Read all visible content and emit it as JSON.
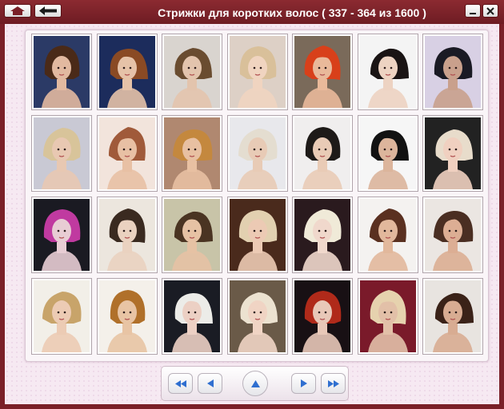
{
  "window": {
    "title": "Стрижки для коротких волос ( 337 - 364 из 1600 )",
    "accent": "#7a2028"
  },
  "titlebar": {
    "home_icon": "home-icon",
    "back_icon": "back-arrow-icon",
    "minimize_icon": "minimize-icon",
    "close_icon": "close-icon"
  },
  "gallery": {
    "rows": 4,
    "columns": 7,
    "thumbnails": [
      {
        "bg": "#2b3a66",
        "hair": "#4a2a18",
        "skin": "#e2b9a0"
      },
      {
        "bg": "#1c2c5c",
        "hair": "#8a4a24",
        "skin": "#e6c2a8"
      },
      {
        "bg": "#d9d4cf",
        "hair": "#6a4c30",
        "skin": "#e3c4ad"
      },
      {
        "bg": "#ddd0c6",
        "hair": "#d9c09a",
        "skin": "#f0d4c0"
      },
      {
        "bg": "#7a6a5a",
        "hair": "#d8401a",
        "skin": "#e9b99a"
      },
      {
        "bg": "#f4f4f4",
        "hair": "#1a1414",
        "skin": "#edd3c2"
      },
      {
        "bg": "#d8d0e4",
        "hair": "#1a1a24",
        "skin": "#c9a08c"
      },
      {
        "bg": "#c9c9d4",
        "hair": "#d8c49a",
        "skin": "#e8c8b2"
      },
      {
        "bg": "#f2e4dc",
        "hair": "#a05a3a",
        "skin": "#e8c0a4"
      },
      {
        "bg": "#b08870",
        "hair": "#c4883e",
        "skin": "#e8c0a2"
      },
      {
        "bg": "#e8e8ec",
        "hair": "#e4ddd0",
        "skin": "#e8cbb6"
      },
      {
        "bg": "#f0eeee",
        "hair": "#1e1a18",
        "skin": "#e9cbb6"
      },
      {
        "bg": "#f6f6f6",
        "hair": "#121212",
        "skin": "#dcb59c"
      },
      {
        "bg": "#222222",
        "hair": "#e8dccb",
        "skin": "#f0d0c0"
      },
      {
        "bg": "#1a1a22",
        "hair": "#c03aa0",
        "skin": "#e8cdd4"
      },
      {
        "bg": "#ece6de",
        "hair": "#3a2a20",
        "skin": "#ead2c0"
      },
      {
        "bg": "#c8c4a8",
        "hair": "#4a3422",
        "skin": "#e6c2a4"
      },
      {
        "bg": "#4a2a1c",
        "hair": "#e2d0b0",
        "skin": "#eccab4"
      },
      {
        "bg": "#2a1a1e",
        "hair": "#f0ead8",
        "skin": "#f0d8cc"
      },
      {
        "bg": "#f4f2f0",
        "hair": "#5a3020",
        "skin": "#e2b89c"
      },
      {
        "bg": "#ebe6e2",
        "hair": "#4a2e22",
        "skin": "#dcae94"
      },
      {
        "bg": "#f2efe8",
        "hair": "#c8a46a",
        "skin": "#eccbb4"
      },
      {
        "bg": "#f4f0ea",
        "hair": "#b0702a",
        "skin": "#e8c4a4"
      },
      {
        "bg": "#1a1c24",
        "hair": "#ecece8",
        "skin": "#ecd0c4"
      },
      {
        "bg": "#6a5a48",
        "hair": "#ece2d0",
        "skin": "#f0d4c4"
      },
      {
        "bg": "#181014",
        "hair": "#b02a1a",
        "skin": "#e8c8b8"
      },
      {
        "bg": "#7a1a2a",
        "hair": "#e6d2ae",
        "skin": "#e2c0a8"
      },
      {
        "bg": "#e8e4e0",
        "hair": "#3a2218",
        "skin": "#d8ac92"
      }
    ]
  },
  "pager": {
    "first_icon": "first-page-icon",
    "prev_icon": "previous-page-icon",
    "up_icon": "up-icon",
    "next_icon": "next-page-icon",
    "last_icon": "last-page-icon",
    "icon_color": "#2f6fd0"
  }
}
